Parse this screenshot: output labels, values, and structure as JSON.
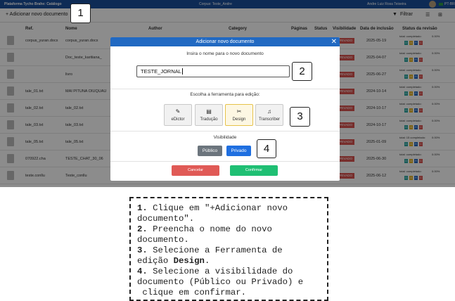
{
  "topbar": {
    "app_title": "Plataforma Tycho Brahe: Catálogo",
    "corpus": "Corpus: Teste_Andre",
    "user": "Andre Luiz Rosa Teixeira",
    "language": "PT-BR"
  },
  "toolbar": {
    "add_label": "+ Adicionar novo documento",
    "filter_label": "Filtrar"
  },
  "table": {
    "headers": [
      "Ref.",
      "Nome",
      "Author",
      "Category",
      "Páginas",
      "Status",
      "Visibilidade",
      "Data de inclusão",
      "Status da revisão"
    ],
    "rows": [
      {
        "ref": "corpus_yuran.docx",
        "name": "corpus_yuran.docx",
        "visibility": "PRIVADO",
        "date": "2025-05-19",
        "status_label": "total:  completado:",
        "status_value": "0.00%"
      },
      {
        "ref": "",
        "name": "Doc_teste_karitiana_",
        "visibility": "PRIVADO",
        "date": "2025-04-07",
        "status_label": "total:  completado:",
        "status_value": "0.00%"
      },
      {
        "ref": "",
        "name": "livro",
        "visibility": "PRIVADO",
        "date": "2025-06-27",
        "status_label": "total:  completado:",
        "status_value": "0.00%"
      },
      {
        "ref": "tale_01.txt",
        "name": "MAI PITUNA OIUQUAU",
        "visibility": "PRIVADO",
        "date": "2024-10-14",
        "status_label": "total:  completado:",
        "status_value": "0.00%"
      },
      {
        "ref": "tale_02.txt",
        "name": "tale_02.txt",
        "visibility": "PRIVADO",
        "date": "2024-10-17",
        "status_label": "total:  completado:",
        "status_value": "0.00%"
      },
      {
        "ref": "tale_03.txt",
        "name": "tale_03.txt",
        "visibility": "PRIVADO",
        "date": "2024-10-17",
        "status_label": "total:  completado:",
        "status_value": "0.00%"
      },
      {
        "ref": "tale_05.txt",
        "name": "tale_05.txt",
        "visibility": "PRIVADO",
        "date": "2025-01-09",
        "status_label": "total: 15  completado:",
        "status_value": "0.00%"
      },
      {
        "ref": "070922.cha",
        "name": "TESTE_CHAT_30_06",
        "visibility": "PRIVADO",
        "date": "2025-06-30",
        "status_label": "total:  completado:",
        "status_value": "0.00%"
      },
      {
        "ref": "teste.conllu",
        "name": "Teste_conllu",
        "visibility": "PRIVADO",
        "date": "2025-06-12",
        "status_label": "total:  completado:",
        "status_value": "0.00%"
      }
    ],
    "status_letters": [
      "D",
      "A",
      "R",
      "C"
    ]
  },
  "modal": {
    "title": "Adicionar novo documento",
    "name_prompt": "Insira o nome para o novo documento",
    "name_value": "TESTE_JORNAL",
    "tool_prompt": "Escolha a ferramenta para edição:",
    "tools": [
      "eDictor",
      "Tradução",
      "Design",
      "Transcriber"
    ],
    "visibility_label": "Visibilidade",
    "public_label": "Público",
    "private_label": "Privado",
    "cancel_label": "Cancelar",
    "confirm_label": "Confirmar"
  },
  "callouts": [
    "1",
    "2",
    "3",
    "4"
  ],
  "instructions": {
    "l1_num": "1.",
    "l1": " Clique em \"+Adicionar novo",
    "l2": "documento\".",
    "l3_num": "2.",
    "l3": " Preencha o nome do novo",
    "l4": "documento.",
    "l5_num": "3.",
    "l5": " Selecione a Ferramenta de",
    "l6a": "edição ",
    "l6b": "Design",
    "l6c": ".",
    "l7_num": "4.",
    "l7": " Selecione a visibilidade do",
    "l8": "documento (Público ou Privado) e",
    "l9": " clique em confirmar."
  },
  "colors": {
    "header_blue": "#1a4f9c",
    "modal_blue": "#2169c2",
    "private_blue": "#1f6fe0",
    "public_gray": "#6c757d",
    "cancel_red": "#e05a56",
    "confirm_green": "#1fbf73",
    "badge_red": "#d9534f",
    "selected_tool_border": "#e6c24a"
  },
  "icons": {
    "edictor": "pencil-square-icon",
    "traducao": "translate-icon",
    "design": "scissors-icon",
    "transcriber": "music-note-icon"
  }
}
